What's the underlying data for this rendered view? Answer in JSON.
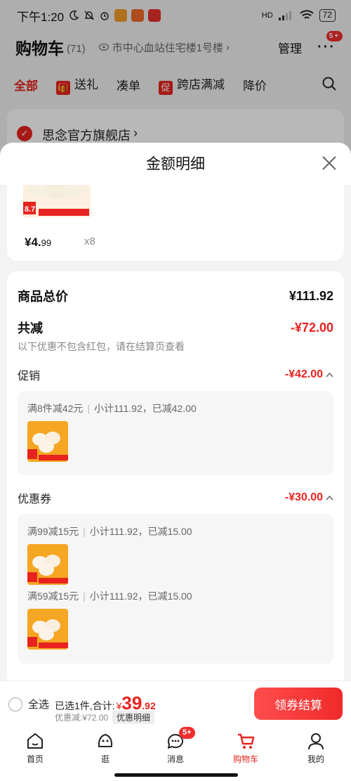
{
  "status_bar": {
    "time": "下午1:20",
    "signal": "HD",
    "battery": "72"
  },
  "header": {
    "title": "购物车",
    "count": "(71)",
    "address": "市中心血站住宅楼1号楼",
    "manage": "管理",
    "more_badge": "5+"
  },
  "filter_tabs": [
    {
      "label": "全部",
      "icon": ""
    },
    {
      "label": "送礼",
      "icon": "gift-icon"
    },
    {
      "label": "凑单",
      "icon": ""
    },
    {
      "label": "跨店满减",
      "icon": "promo-icon",
      "icon_text": "促"
    },
    {
      "label": "降价",
      "icon": ""
    }
  ],
  "shop": {
    "name": "思念官方旗舰店"
  },
  "sheet": {
    "title": "金额明细",
    "product": {
      "price_int": "¥4.",
      "price_dec": "99",
      "quantity": "x8",
      "thumb_badge": "8.7"
    },
    "summary": {
      "total_label": "商品总价",
      "total_value": "¥111.92",
      "discount_label": "共减",
      "discount_value": "-¥72.00",
      "note": "以下优惠不包含红包，请在结算页查看"
    },
    "promotion": {
      "label": "促销",
      "value": "-¥42.00",
      "items": [
        {
          "rule": "满8件减42元",
          "detail": "小计111.92，已减42.00"
        }
      ]
    },
    "coupon": {
      "label": "优惠券",
      "value": "-¥30.00",
      "items": [
        {
          "rule": "满99减15元",
          "detail": "小计111.92，已减15.00"
        },
        {
          "rule": "满59减15元",
          "detail": "小计111.92，已减15.00"
        }
      ]
    }
  },
  "checkout": {
    "select_all": "全选",
    "selected_text": "已选1件,合计:",
    "total_yen": "¥",
    "total_int": "39",
    "total_dec": ".92",
    "discount_text": "优惠减:¥72.00",
    "detail_chip": "优惠明细",
    "pay_button": "领券结算"
  },
  "bottom_nav": [
    {
      "label": "首页",
      "icon": "home-icon"
    },
    {
      "label": "逛",
      "icon": "browse-icon"
    },
    {
      "label": "消息",
      "icon": "message-icon",
      "badge": "5+"
    },
    {
      "label": "购物车",
      "icon": "cart-icon",
      "active": true
    },
    {
      "label": "我的",
      "icon": "profile-icon"
    }
  ],
  "colors": {
    "accent": "#e8231f",
    "sheet_bg": "#f3f3f3",
    "card_bg": "#ffffff"
  }
}
